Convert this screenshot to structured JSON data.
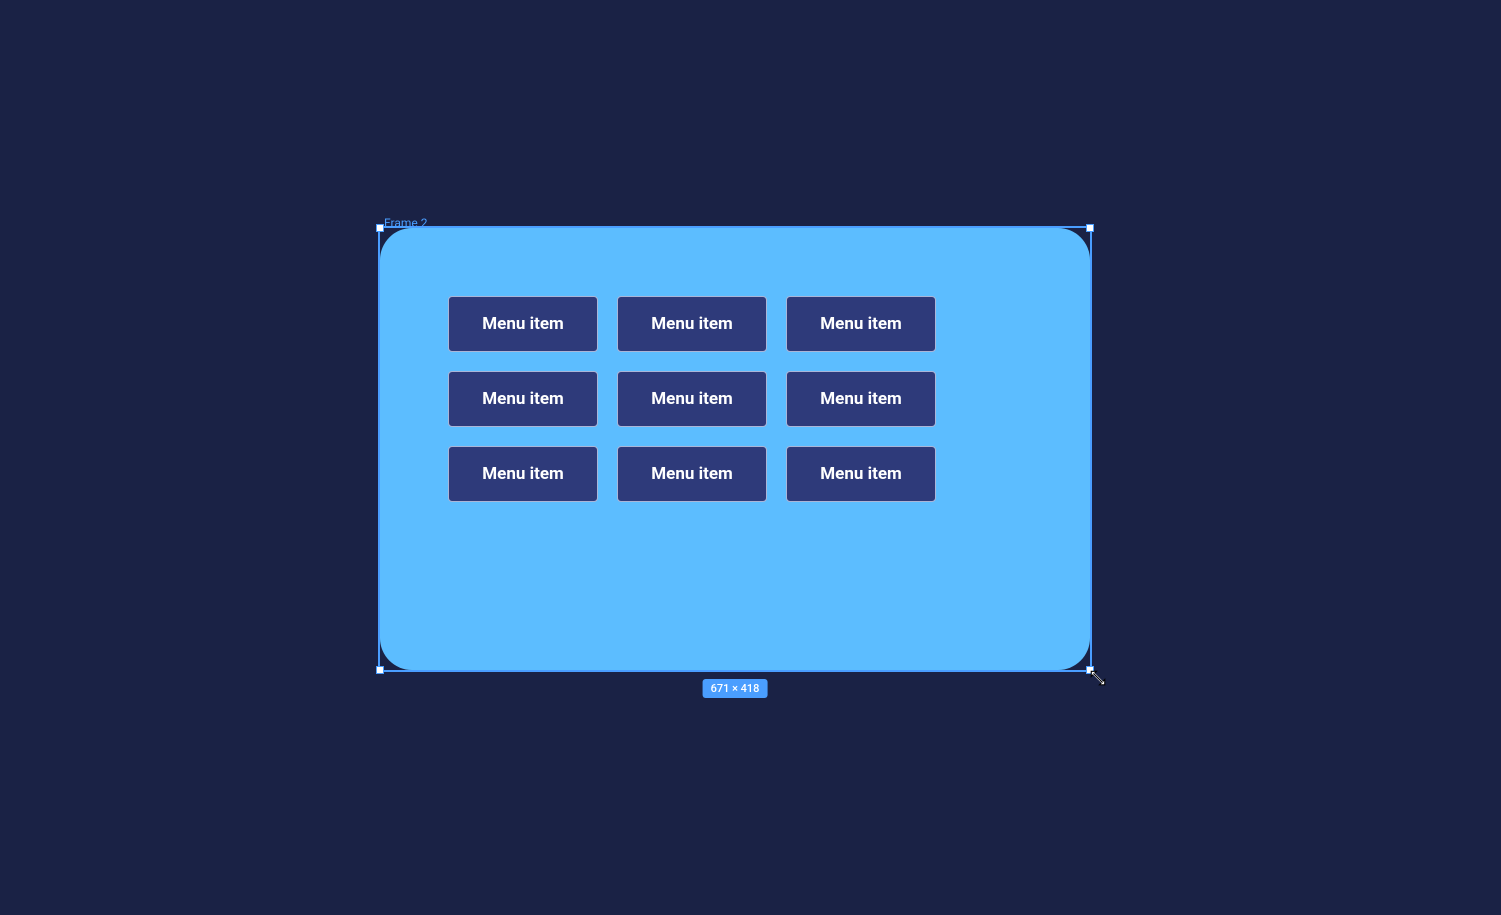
{
  "canvas": {
    "frame": {
      "label": "Frame 2",
      "dimensions": "671 × 418",
      "menu_items": [
        {
          "label": "Menu item"
        },
        {
          "label": "Menu item"
        },
        {
          "label": "Menu item"
        },
        {
          "label": "Menu item"
        },
        {
          "label": "Menu item"
        },
        {
          "label": "Menu item"
        },
        {
          "label": "Menu item"
        },
        {
          "label": "Menu item"
        },
        {
          "label": "Menu item"
        }
      ]
    }
  }
}
